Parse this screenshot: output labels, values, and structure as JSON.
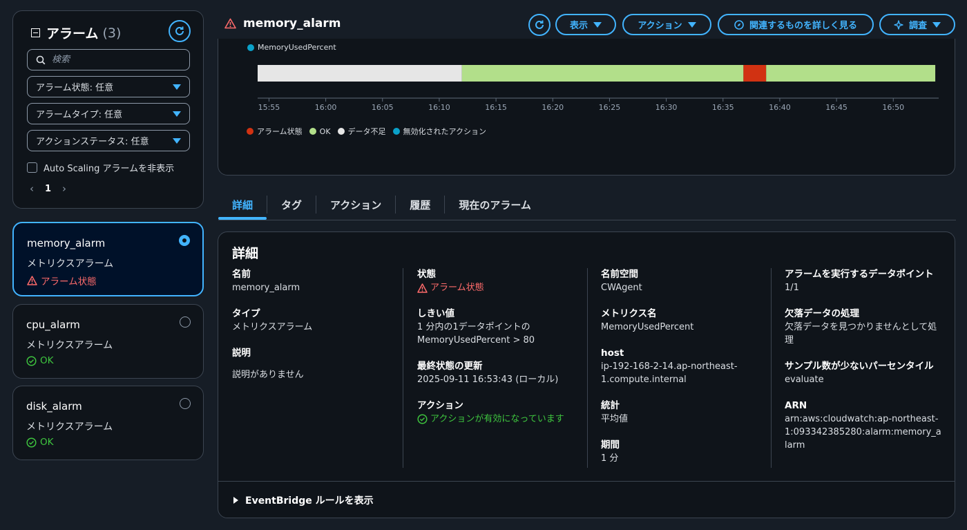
{
  "sidebar": {
    "title": "アラーム",
    "count": "(3)",
    "search_placeholder": "検索",
    "filters": [
      "アラーム状態: 任意",
      "アラームタイプ: 任意",
      "アクションステータス: 任意"
    ],
    "hide_autoscaling_label": "Auto Scaling アラームを非表示",
    "page_number": "1",
    "alarms": [
      {
        "name": "memory_alarm",
        "type": "メトリクスアラーム",
        "status": "アラーム状態",
        "state": "alarm",
        "selected": true
      },
      {
        "name": "cpu_alarm",
        "type": "メトリクスアラーム",
        "status": "OK",
        "state": "ok",
        "selected": false
      },
      {
        "name": "disk_alarm",
        "type": "メトリクスアラーム",
        "status": "OK",
        "state": "ok",
        "selected": false
      }
    ]
  },
  "header": {
    "title": "memory_alarm",
    "buttons": {
      "display": "表示",
      "action": "アクション",
      "related": "関連するものを詳しく見る",
      "investigate": "調査"
    }
  },
  "colors": {
    "accent": "#42b4ff",
    "alarm": "#d13212",
    "ok": "#b2df8a",
    "insufficient": "#e6e6e6",
    "disabled_action": "#0aa1c9"
  },
  "chart_data": {
    "type": "timeline",
    "series_label": "MemoryUsedPercent",
    "x_ticks": [
      "15:55",
      "16:00",
      "16:05",
      "16:10",
      "16:15",
      "16:20",
      "16:25",
      "16:30",
      "16:35",
      "16:40",
      "16:45",
      "16:50"
    ],
    "x_range": [
      "15:54",
      "16:54"
    ],
    "segments": [
      {
        "start": "15:54",
        "end": "16:12",
        "state": "insufficient"
      },
      {
        "start": "16:12",
        "end": "16:36.8",
        "state": "ok"
      },
      {
        "start": "16:36.8",
        "end": "16:38.8",
        "state": "alarm"
      },
      {
        "start": "16:38.8",
        "end": "16:53.7",
        "state": "ok"
      }
    ],
    "legend": [
      {
        "label": "アラーム状態",
        "state": "alarm"
      },
      {
        "label": "OK",
        "state": "ok"
      },
      {
        "label": "データ不足",
        "state": "insufficient"
      },
      {
        "label": "無効化されたアクション",
        "state": "disabled_action"
      }
    ]
  },
  "tabs": [
    "詳細",
    "タグ",
    "アクション",
    "履歴",
    "現在のアラーム"
  ],
  "details": {
    "heading": "詳細",
    "col1": [
      {
        "label": "名前",
        "value": "memory_alarm"
      },
      {
        "label": "タイプ",
        "value": "メトリクスアラーム"
      },
      {
        "label": "説明",
        "value": "説明がありません"
      }
    ],
    "col2": [
      {
        "label": "状態",
        "value": "アラーム状態"
      },
      {
        "label": "しきい値",
        "value": "1 分内の1データポイントの MemoryUsedPercent > 80"
      },
      {
        "label": "最終状態の更新",
        "value": "2025-09-11 16:53:43 (ローカル)"
      },
      {
        "label": "アクション",
        "value": "アクションが有効になっています"
      }
    ],
    "col3": [
      {
        "label": "名前空間",
        "value": "CWAgent"
      },
      {
        "label": "メトリクス名",
        "value": "MemoryUsedPercent"
      },
      {
        "label": "host",
        "value": "ip-192-168-2-14.ap-northeast-1.compute.internal"
      },
      {
        "label": "統計",
        "value": "平均値"
      },
      {
        "label": "期間",
        "value": "1 分"
      }
    ],
    "col4": [
      {
        "label": "アラームを実行するデータポイント",
        "value": "1/1"
      },
      {
        "label": "欠落データの処理",
        "value": "欠落データを見つかりませんとして処理"
      },
      {
        "label": "サンプル数が少ないパーセンタイル",
        "value": "evaluate"
      },
      {
        "label": "ARN",
        "value": "arn:aws:cloudwatch:ap-northeast-1:093342385280:alarm:memory_alarm"
      }
    ],
    "eventbridge_label": "EventBridge ルールを表示"
  }
}
